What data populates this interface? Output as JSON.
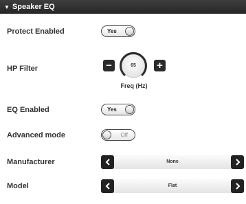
{
  "header": {
    "title": "Speaker EQ",
    "icon": "chevron-down-icon"
  },
  "protect": {
    "label": "Protect Enabled",
    "value": "Yes"
  },
  "hp_filter": {
    "label": "HP Filter",
    "value": "65",
    "unit_label": "Freq (Hz)"
  },
  "eq": {
    "label": "EQ Enabled",
    "value": "Yes"
  },
  "advanced": {
    "label": "Advanced mode",
    "value": "Off"
  },
  "manufacturer": {
    "label": "Manufacturer",
    "value": "None"
  },
  "model": {
    "label": "Model",
    "value": "Flat"
  }
}
